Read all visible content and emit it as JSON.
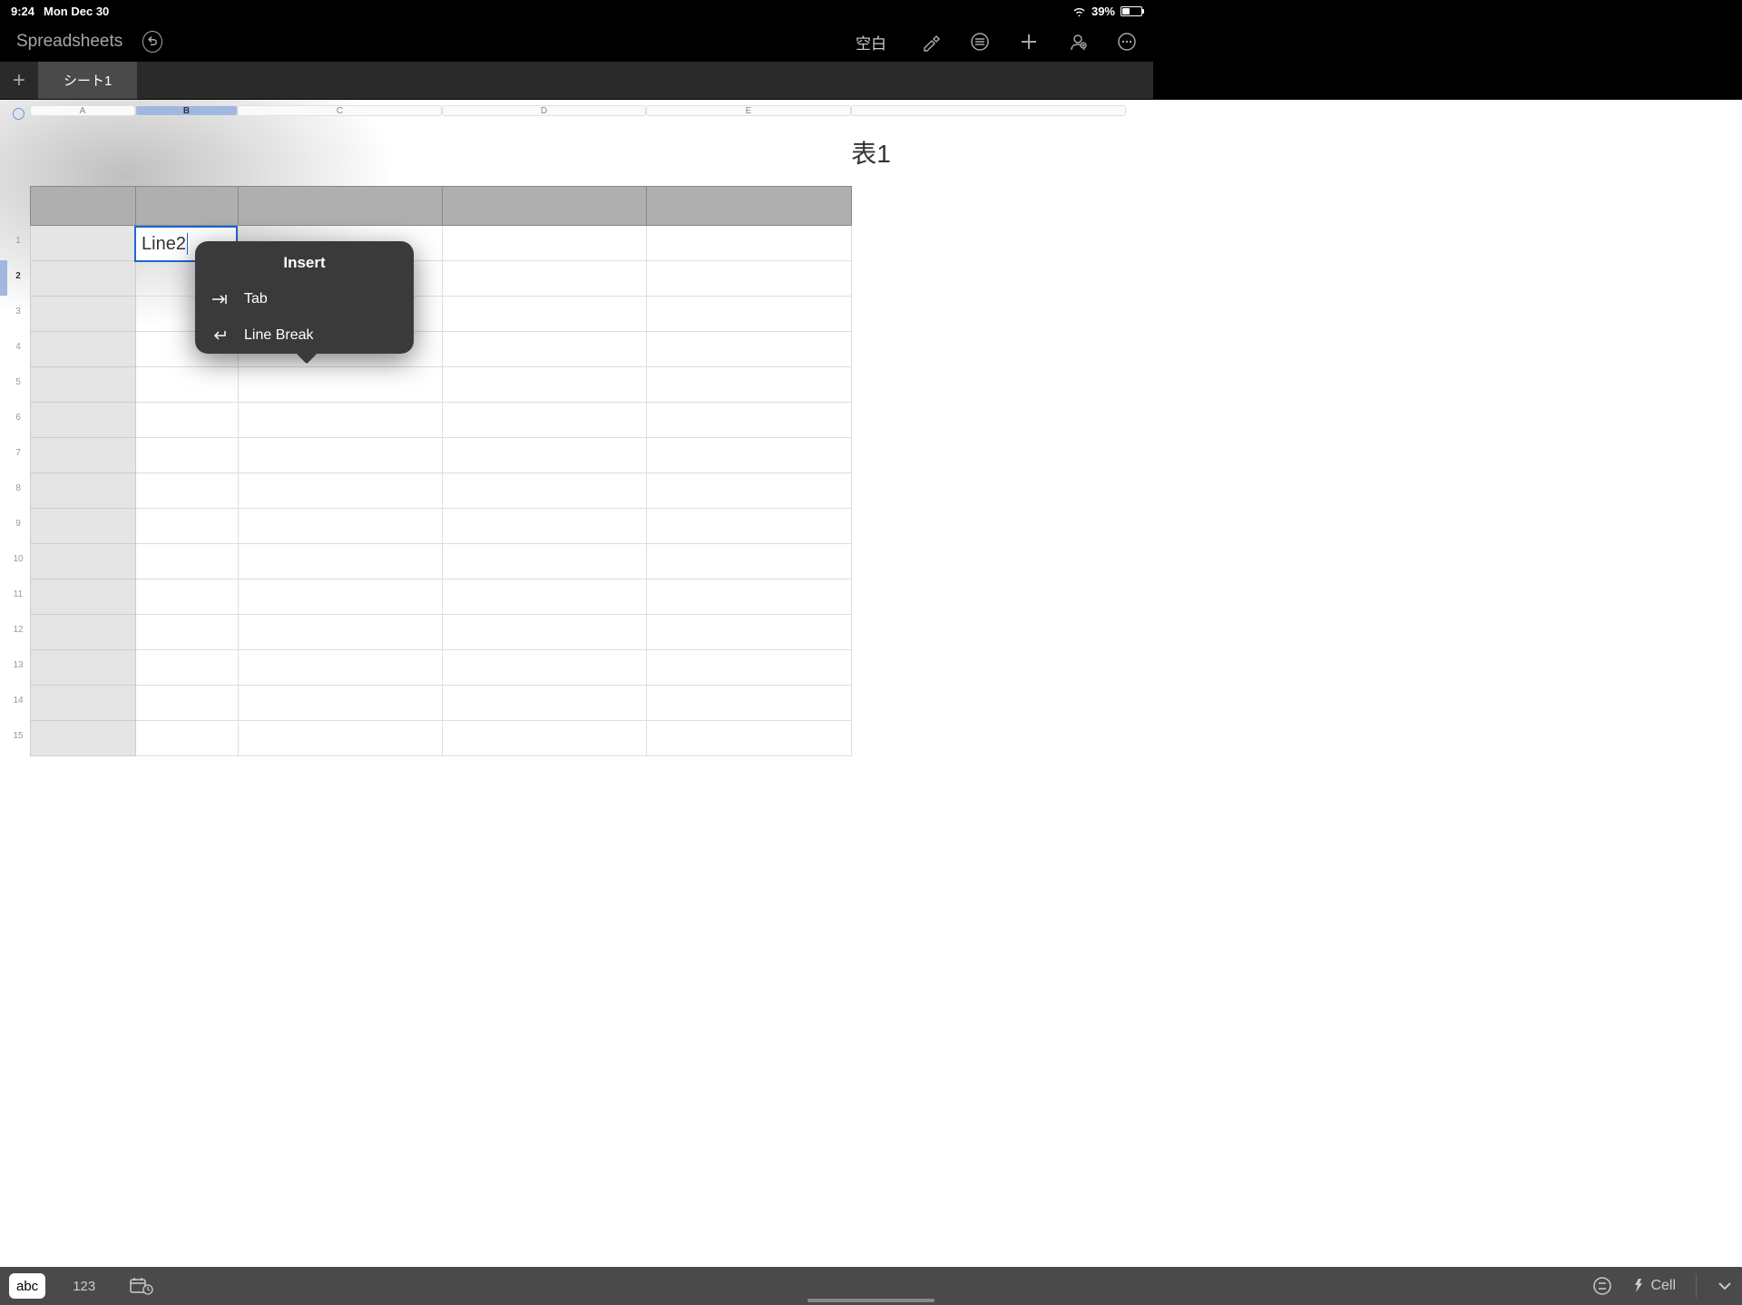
{
  "status": {
    "time": "9:24",
    "date": "Mon Dec 30",
    "battery": "39%"
  },
  "toolbar": {
    "back_label": "Spreadsheets",
    "doc_title": "空白"
  },
  "sheets": {
    "active": "シート1"
  },
  "table": {
    "title": "表1",
    "columns": [
      "A",
      "B",
      "C",
      "D",
      "E"
    ],
    "row_count": 15,
    "selected_cell": {
      "ref": "B2",
      "value": "Line2"
    }
  },
  "popover": {
    "title": "Insert",
    "items": [
      {
        "icon": "tab",
        "label": "Tab"
      },
      {
        "icon": "return",
        "label": "Line Break"
      }
    ]
  },
  "bottom": {
    "mode_text": "abc",
    "mode_num": "123",
    "cell_label": "Cell"
  }
}
